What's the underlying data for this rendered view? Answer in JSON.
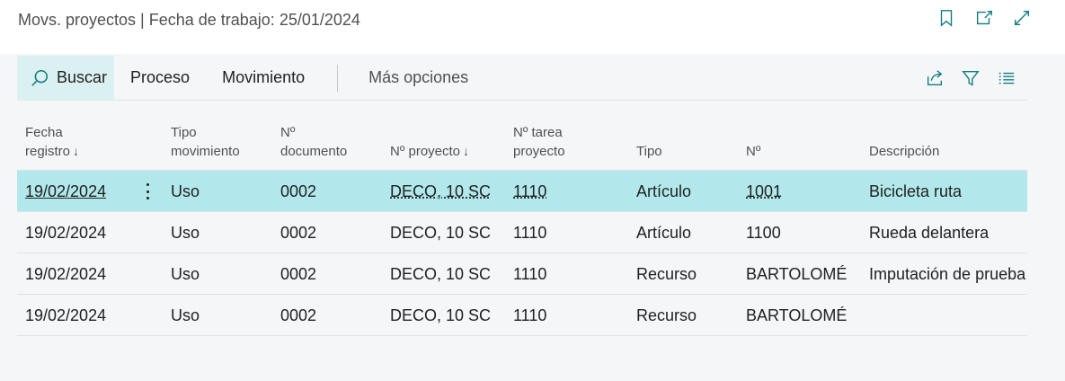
{
  "page": {
    "title": "Movs. proyectos | Fecha de trabajo: 25/01/2024",
    "icons": [
      "bookmark-icon",
      "open-new-window-icon",
      "expand-icon"
    ]
  },
  "actions": {
    "search": "Buscar",
    "process": "Proceso",
    "movement": "Movimiento",
    "more": "Más opciones",
    "right_icons": [
      "share-icon",
      "filter-icon",
      "list-view-icon"
    ]
  },
  "columns": [
    {
      "line1": "Fecha",
      "line2": "registro",
      "sorted": "↓"
    },
    {
      "line1": "Tipo",
      "line2": "movimiento",
      "sorted": ""
    },
    {
      "line1": "Nº",
      "line2": "documento",
      "sorted": ""
    },
    {
      "line1": "",
      "line2": "Nº proyecto",
      "sorted": "↓"
    },
    {
      "line1": "Nº tarea",
      "line2": "proyecto",
      "sorted": ""
    },
    {
      "line1": "",
      "line2": "Tipo",
      "sorted": ""
    },
    {
      "line1": "",
      "line2": "Nº",
      "sorted": ""
    },
    {
      "line1": "",
      "line2": "Descripción",
      "sorted": ""
    }
  ],
  "rows": [
    {
      "fecha": "19/02/2024",
      "tipo_mov": "Uso",
      "documento": "0002",
      "proyecto": "DECO, 10 SC",
      "tarea": "1110",
      "tipo": "Artículo",
      "numero": "1001",
      "descripcion": "Bicicleta ruta"
    },
    {
      "fecha": "19/02/2024",
      "tipo_mov": "Uso",
      "documento": "0002",
      "proyecto": "DECO, 10 SC",
      "tarea": "1110",
      "tipo": "Artículo",
      "numero": "1100",
      "descripcion": "Rueda delantera"
    },
    {
      "fecha": "19/02/2024",
      "tipo_mov": "Uso",
      "documento": "0002",
      "proyecto": "DECO, 10 SC",
      "tarea": "1110",
      "tipo": "Recurso",
      "numero": "BARTOLOMÉ",
      "descripcion": "Imputación de prueba"
    },
    {
      "fecha": "19/02/2024",
      "tipo_mov": "Uso",
      "documento": "0002",
      "proyecto": "DECO, 10 SC",
      "tarea": "1110",
      "tipo": "Recurso",
      "numero": "BARTOLOMÉ",
      "descripcion": ""
    }
  ],
  "colors": {
    "accent": "#0f7d80",
    "selected_row": "#b2e8eb",
    "search_bg": "#dbf0f1"
  }
}
